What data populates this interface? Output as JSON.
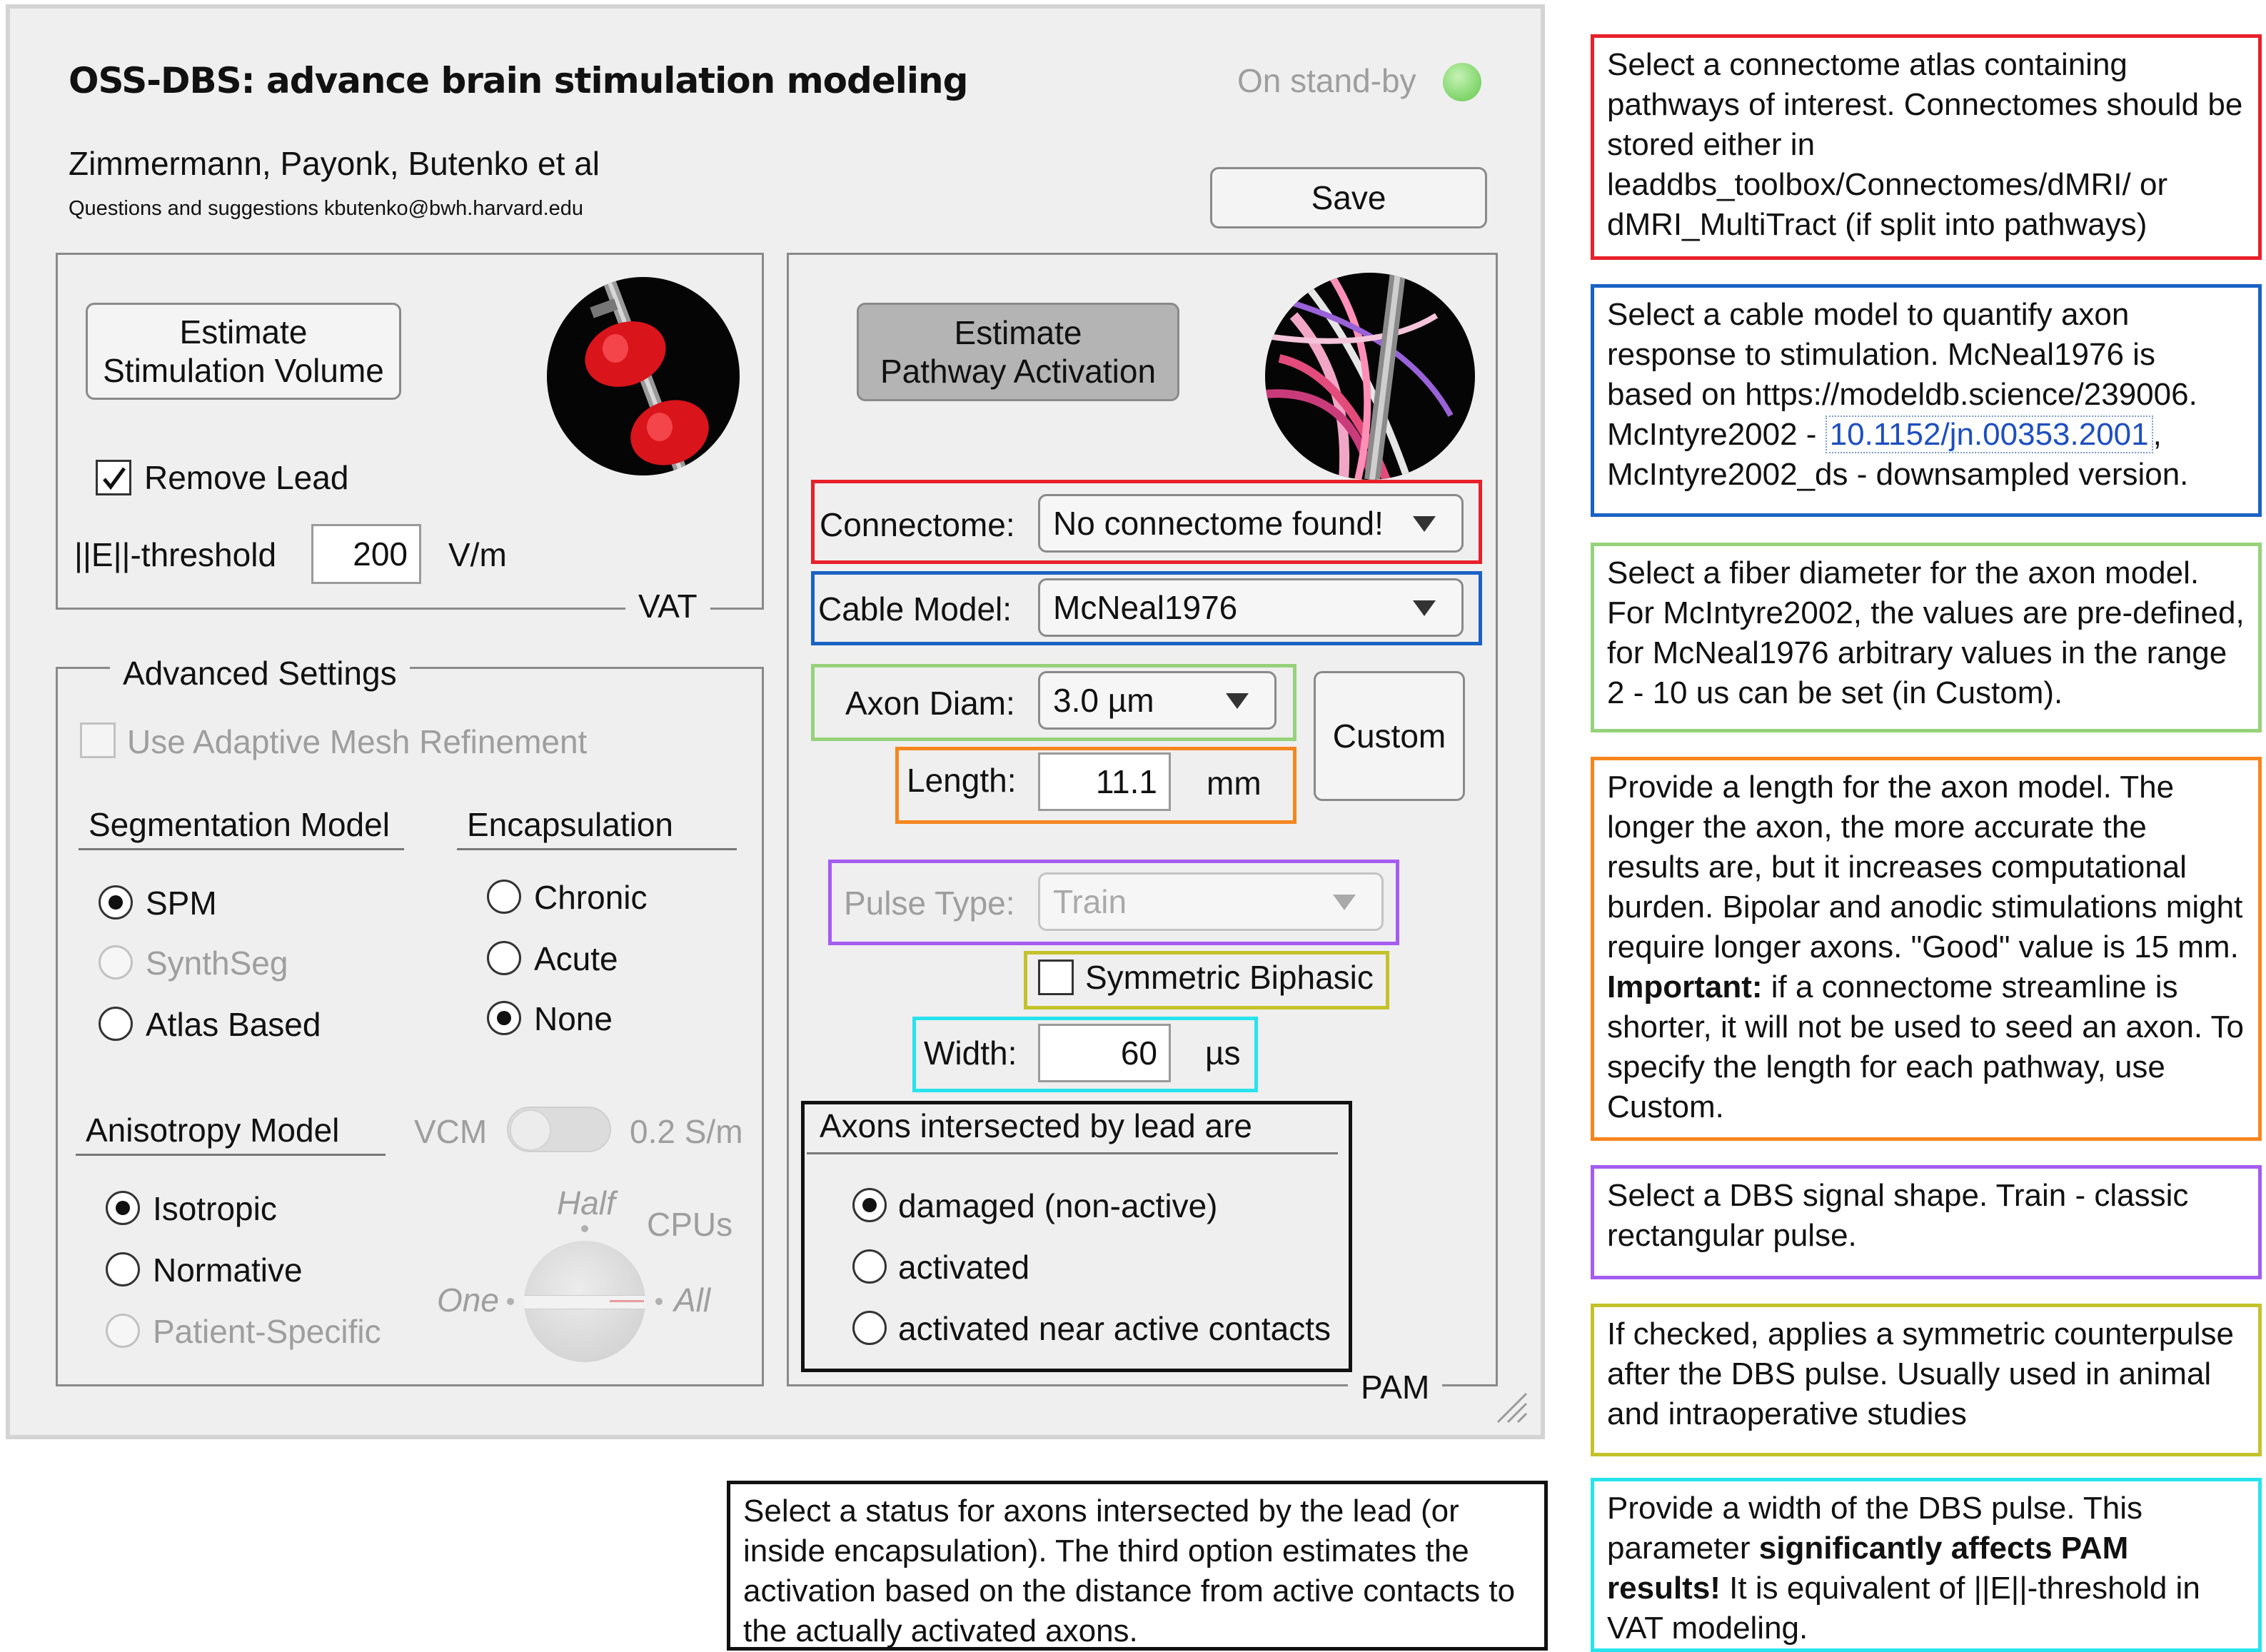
{
  "app": {
    "title": "OSS-DBS: advance brain stimulation modeling",
    "status_text": "On stand-by",
    "status_color": "#8edc7a",
    "authors": "Zimmermann, Payonk, Butenko et al",
    "contact": "Questions and suggestions kbutenko@bwh.harvard.edu",
    "save_label": "Save"
  },
  "vat": {
    "panel_label": "VAT",
    "estimate_button": [
      "Estimate",
      "Stimulation Volume"
    ],
    "remove_lead_label": "Remove Lead",
    "remove_lead_checked": true,
    "threshold_label": "||E||-threshold",
    "threshold_value": "200",
    "threshold_unit": "V/m"
  },
  "advanced": {
    "title": "Advanced Settings",
    "adaptive_mesh_label": "Use Adaptive Mesh Refinement",
    "segmentation": {
      "title": "Segmentation Model",
      "options": [
        "SPM",
        "SynthSeg",
        "Atlas Based"
      ],
      "selected": "SPM"
    },
    "encapsulation": {
      "title": "Encapsulation",
      "options": [
        "Chronic",
        "Acute",
        "None"
      ],
      "selected": "None"
    },
    "anisotropy": {
      "title": "Anisotropy Model",
      "options": [
        "Isotropic",
        "Normative",
        "Patient-Specific"
      ],
      "selected": "Isotropic"
    },
    "vcm_label": "VCM",
    "conductivity": "0.2 S/m",
    "cpus": {
      "title": "CPUs",
      "one": "One",
      "half": "Half",
      "all": "All"
    }
  },
  "pam": {
    "panel_label": "PAM",
    "estimate_button": [
      "Estimate",
      "Pathway Activation"
    ],
    "connectome_label": "Connectome:",
    "connectome_value": "No connectome found!",
    "cable_label": "Cable Model:",
    "cable_value": "McNeal1976",
    "axon_diam_label": "Axon Diam:",
    "axon_diam_value": "3.0 µm",
    "custom_label": "Custom",
    "length_label": "Length:",
    "length_value": "11.1",
    "length_unit": "mm",
    "pulse_label": "Pulse Type:",
    "pulse_value": "Train",
    "symmetric_label": "Symmetric Biphasic",
    "symmetric_checked": false,
    "width_label": "Width:",
    "width_value": "60",
    "width_unit": "µs",
    "axons_title": "Axons intersected by lead are",
    "axons_options": [
      "damaged (non-active)",
      "activated",
      "activated near active contacts"
    ],
    "axons_selected": "damaged (non-active)"
  },
  "notes": {
    "connectome": "Select a connectome atlas containing pathways of interest. Connectomes should be stored either in leaddbs_toolbox/Connectomes/dMRI/ or dMRI_MultiTract (if split into pathways)",
    "cable_a": "Select a cable model to quantify axon response to stimulation. McNeal1976 is based on https://modeldb.science/239006. McIntyre2002 - ",
    "cable_link": "10.1152/jn.00353.2001",
    "cable_b": ", McIntyre2002_ds - downsampled version.",
    "fiber": "Select a fiber diameter for the axon model. For McIntyre2002, the values are pre-defined, for McNeal1976 arbitrary values in the range 2 - 10 us can be set (in Custom).",
    "length_a": "Provide a length for the axon model. The longer the axon, the more accurate the results are, but it increases computational burden. Bipolar and anodic stimulations might require longer axons. \"Good\" value is 15 mm. ",
    "length_bold": "Important:",
    "length_b": " if a connectome streamline is shorter, it will not be used to seed an axon. To specify the length for each pathway, use Custom.",
    "pulse": "Select a DBS signal shape. Train - classic rectangular pulse.",
    "symmetric": "If checked, applies a symmetric counterpulse after the DBS pulse. Usually used in animal and intraoperative studies",
    "width_a": "Provide a width of the DBS pulse. This parameter ",
    "width_bold": "significantly affects PAM results!",
    "width_b": " It is equivalent of ||E||-threshold in VAT modeling.",
    "axons": "Select a status for axons intersected by the lead (or inside encapsulation). The third option estimates the activation based on the distance from active contacts to the actually activated axons."
  },
  "colors": {
    "red": "#e8202a",
    "blue": "#1a62c4",
    "green": "#96d27a",
    "orange": "#f5861e",
    "purple": "#a45cf0",
    "olive": "#c4c22a",
    "cyan": "#27e3ee",
    "black": "#111111"
  },
  "icons": {
    "vat_image": "lead-with-red-electrodes-image",
    "pam_image": "lead-with-pink-fiber-tracts-image"
  }
}
